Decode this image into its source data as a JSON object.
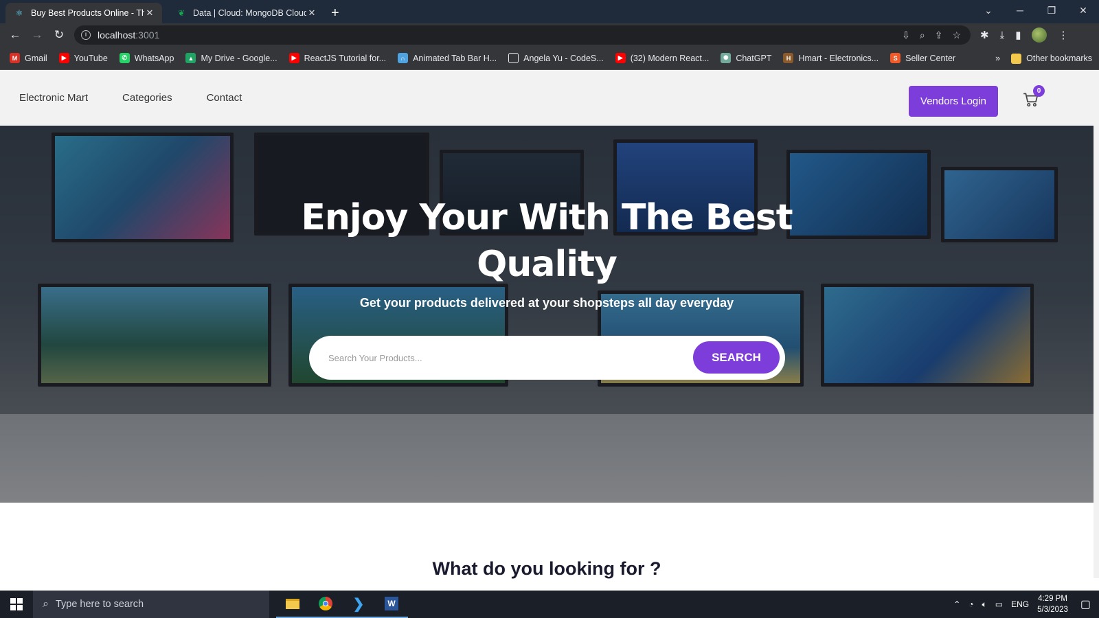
{
  "browser": {
    "tabs": [
      {
        "title": "Buy Best Products Online - TheC",
        "icon": "react-icon",
        "active": true
      },
      {
        "title": "Data | Cloud: MongoDB Cloud",
        "icon": "mongodb-leaf-icon",
        "active": false
      }
    ],
    "url_host": "localhost",
    "url_port": ":3001",
    "bookmarks": [
      {
        "label": "Gmail",
        "icon": "gmail-icon",
        "color": "#d93025"
      },
      {
        "label": "YouTube",
        "icon": "youtube-icon",
        "color": "#ff0000"
      },
      {
        "label": "WhatsApp",
        "icon": "whatsapp-icon",
        "color": "#25d366"
      },
      {
        "label": "My Drive - Google...",
        "icon": "drive-icon",
        "color": "#1fa463"
      },
      {
        "label": "ReactJS Tutorial for...",
        "icon": "youtube-icon",
        "color": "#ff0000"
      },
      {
        "label": "Animated Tab Bar H...",
        "icon": "headphones-icon",
        "color": "#4fa3e0"
      },
      {
        "label": "Angela Yu - CodeS...",
        "icon": "square-icon",
        "color": "#35363a"
      },
      {
        "label": "(32) Modern React...",
        "icon": "youtube-icon",
        "color": "#ff0000"
      },
      {
        "label": "ChatGPT",
        "icon": "chatgpt-icon",
        "color": "#74aa9c"
      },
      {
        "label": "Hmart - Electronics...",
        "icon": "hmart-icon",
        "color": "#8a5a2b"
      },
      {
        "label": "Seller Center",
        "icon": "seller-icon",
        "color": "#f05a28"
      }
    ],
    "more_bookmarks": "»",
    "other_bookmarks": "Other bookmarks"
  },
  "site": {
    "nav": [
      "Electronic Mart",
      "Categories",
      "Contact"
    ],
    "vendor_button": "Vendors Login",
    "cart_count": "0",
    "hero_title_line1": "Enjoy Your With The Best",
    "hero_title_line2": "Quality",
    "hero_subtitle": "Get your products delivered at your shopsteps all day everyday",
    "search_placeholder": "Search Your Products...",
    "search_button": "SEARCH",
    "section_title": "What do you looking for ?",
    "accent_color": "#7c3ddb"
  },
  "taskbar": {
    "search_placeholder": "Type here to search",
    "language": "ENG",
    "time": "4:29 PM",
    "date": "5/3/2023"
  }
}
